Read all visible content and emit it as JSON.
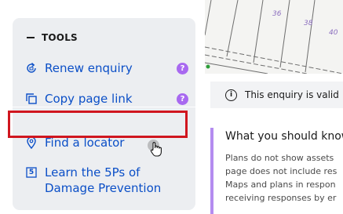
{
  "tools": {
    "heading": "TOOLS",
    "items": [
      {
        "label": "Renew enquiry",
        "icon": "renew-icon",
        "help": "?"
      },
      {
        "label": "Copy page link",
        "icon": "copy-icon",
        "help": "?"
      },
      {
        "label": "Find a locator",
        "icon": "location-pin-icon"
      },
      {
        "label": "Learn the 5Ps of",
        "label2": "Damage Prevention",
        "icon": "number-5-icon",
        "icon_text": "5"
      }
    ]
  },
  "map": {
    "lot_numbers": [
      "36",
      "38",
      "40"
    ]
  },
  "notice": {
    "icon_text": "i",
    "text": "This enquiry is valid"
  },
  "know": {
    "title": "What you should know",
    "lines": [
      "Plans do not show assets",
      "page does not include res",
      "Maps and plans in respon",
      "receiving responses by er"
    ]
  },
  "colors": {
    "link": "#0b4fc7",
    "help_badge": "#a869f0",
    "highlight": "#d0161f",
    "accent_bar": "#b48cf0",
    "panel_bg": "#eceef1"
  }
}
